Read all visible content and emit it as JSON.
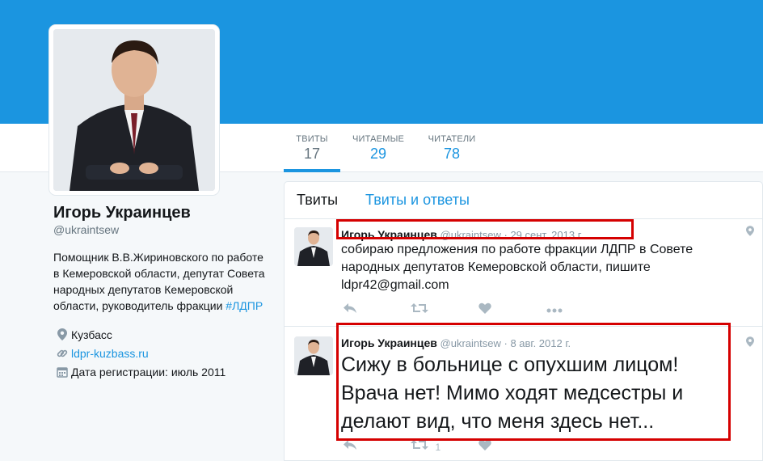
{
  "profile": {
    "name": "Игорь Украинцев",
    "handle": "@ukraintsew",
    "bio": "Помощник В.В.Жириновского по работе в Кемеровской области, депутат Совета народных депутатов Кемеровской области, руководитель фракции",
    "bio_hashtag": "#ЛДПР",
    "location": "Кузбасс",
    "website": "ldpr-kuzbass.ru",
    "joined": "Дата регистрации: июль 2011"
  },
  "stats": [
    {
      "label": "ТВИТЫ",
      "value": "17"
    },
    {
      "label": "ЧИТАЕМЫЕ",
      "value": "29"
    },
    {
      "label": "ЧИТАТЕЛИ",
      "value": "78"
    }
  ],
  "tabs": {
    "tweets": "Твиты",
    "tweets_replies": "Твиты и ответы"
  },
  "tweets": [
    {
      "name": "Игорь Украинцев",
      "handle": "@ukraintsew",
      "sep": "·",
      "date": "29 сент. 2013 г.",
      "text": "собираю предложения по работе фракции ЛДПР в Совете народных депутатов Кемеровской области, пишите ldpr42@gmail.com",
      "retweet_count": "",
      "like_count": ""
    },
    {
      "name": "Игорь Украинцев",
      "handle": "@ukraintsew",
      "sep": "·",
      "date": "8 авг. 2012 г.",
      "text": "Сижу в больнице с опухшим лицом! Врача нет! Мимо ходят медсестры и делают вид, что меня здесь нет...",
      "retweet_count": "1",
      "like_count": ""
    }
  ],
  "icons": {
    "location": "map-pin-icon",
    "link": "link-icon",
    "calendar": "calendar-icon",
    "reply": "reply-icon",
    "retweet": "retweet-icon",
    "like": "heart-icon",
    "more": "more-icon"
  },
  "colors": {
    "banner": "#1b95e0",
    "accent": "#1b95e0",
    "highlight": "#d50000"
  }
}
